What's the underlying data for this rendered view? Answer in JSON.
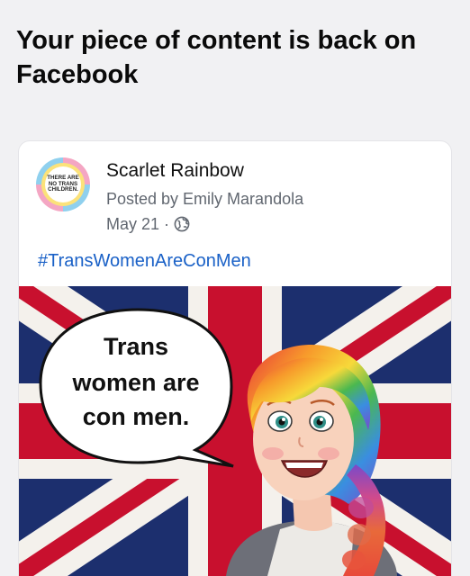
{
  "heading": "Your piece of content is back on Facebook",
  "post": {
    "page_name": "Scarlet Rainbow",
    "posted_by": "Posted by Emily Marandola",
    "date": "May 21",
    "separator": "·",
    "hashtag": "#TransWomenAreConMen",
    "avatar_text": [
      "THERE ARE",
      "NO TRANS",
      "CHILDREN."
    ],
    "audience_icon": "globe-icon",
    "image": {
      "speech_lines": [
        "Trans",
        "women are",
        "con men."
      ],
      "background": "union-flag",
      "flag_colors": {
        "blue": "#1c2f6e",
        "red": "#c8102e",
        "white": "#f4f1ec"
      }
    }
  }
}
